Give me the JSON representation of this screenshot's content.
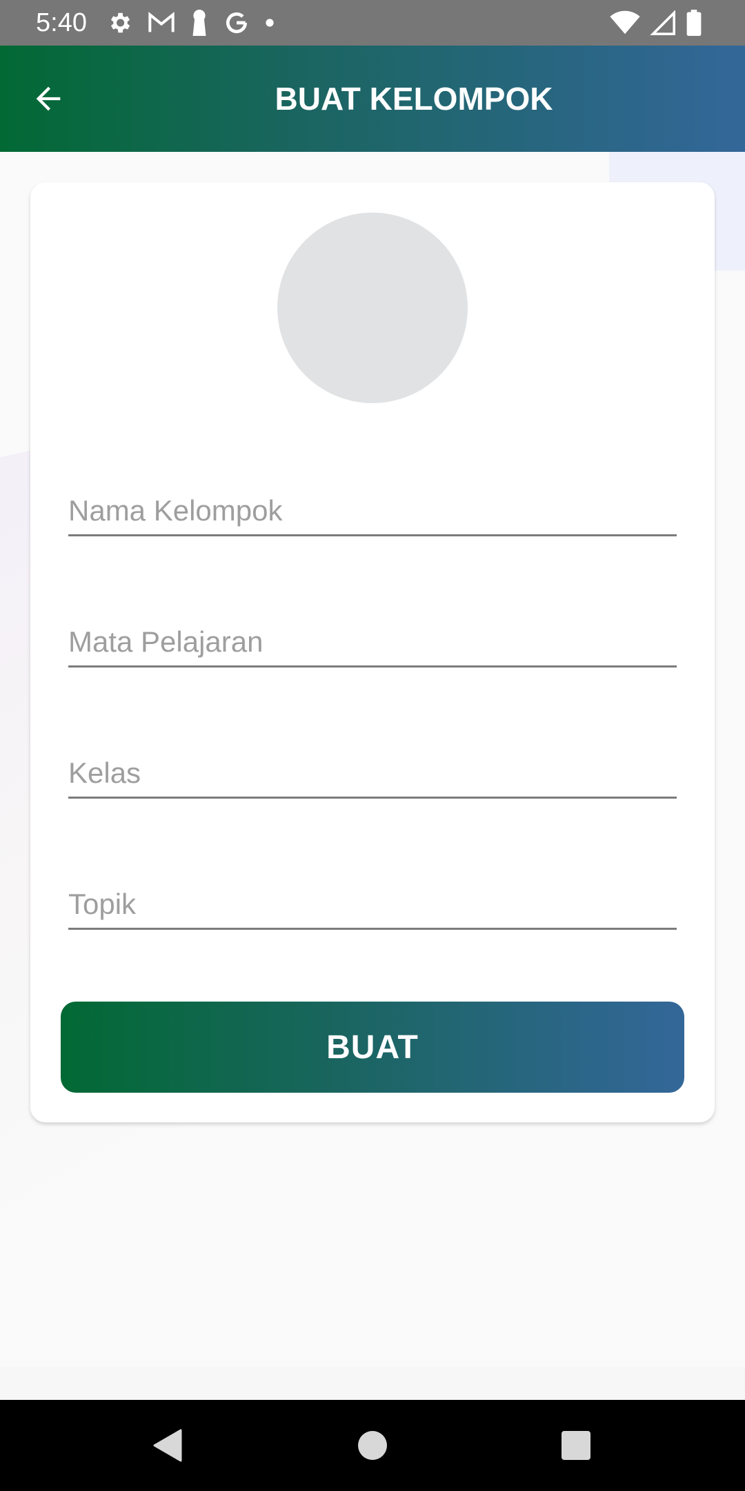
{
  "status_bar": {
    "time": "5:40",
    "left_icons": [
      "gear-icon",
      "gmail-icon",
      "keyhole-icon",
      "google-icon",
      "dot-icon"
    ],
    "right_icons": [
      "wifi-icon",
      "cellular-signal-icon",
      "battery-icon"
    ]
  },
  "app_bar": {
    "title": "BUAT KELOMPOK",
    "back_icon": "arrow-back-icon",
    "gradient": [
      "#026934",
      "#336799"
    ]
  },
  "form": {
    "avatar_placeholder_color": "#e1e2e4",
    "fields": [
      {
        "placeholder": "Nama Kelompok",
        "value": ""
      },
      {
        "placeholder": "Mata Pelajaran",
        "value": ""
      },
      {
        "placeholder": "Kelas",
        "value": ""
      },
      {
        "placeholder": "Topik",
        "value": ""
      }
    ],
    "submit_label": "BUAT"
  },
  "nav_bar": {
    "buttons": [
      "back-triangle-icon",
      "home-circle-icon",
      "recents-square-icon"
    ]
  }
}
